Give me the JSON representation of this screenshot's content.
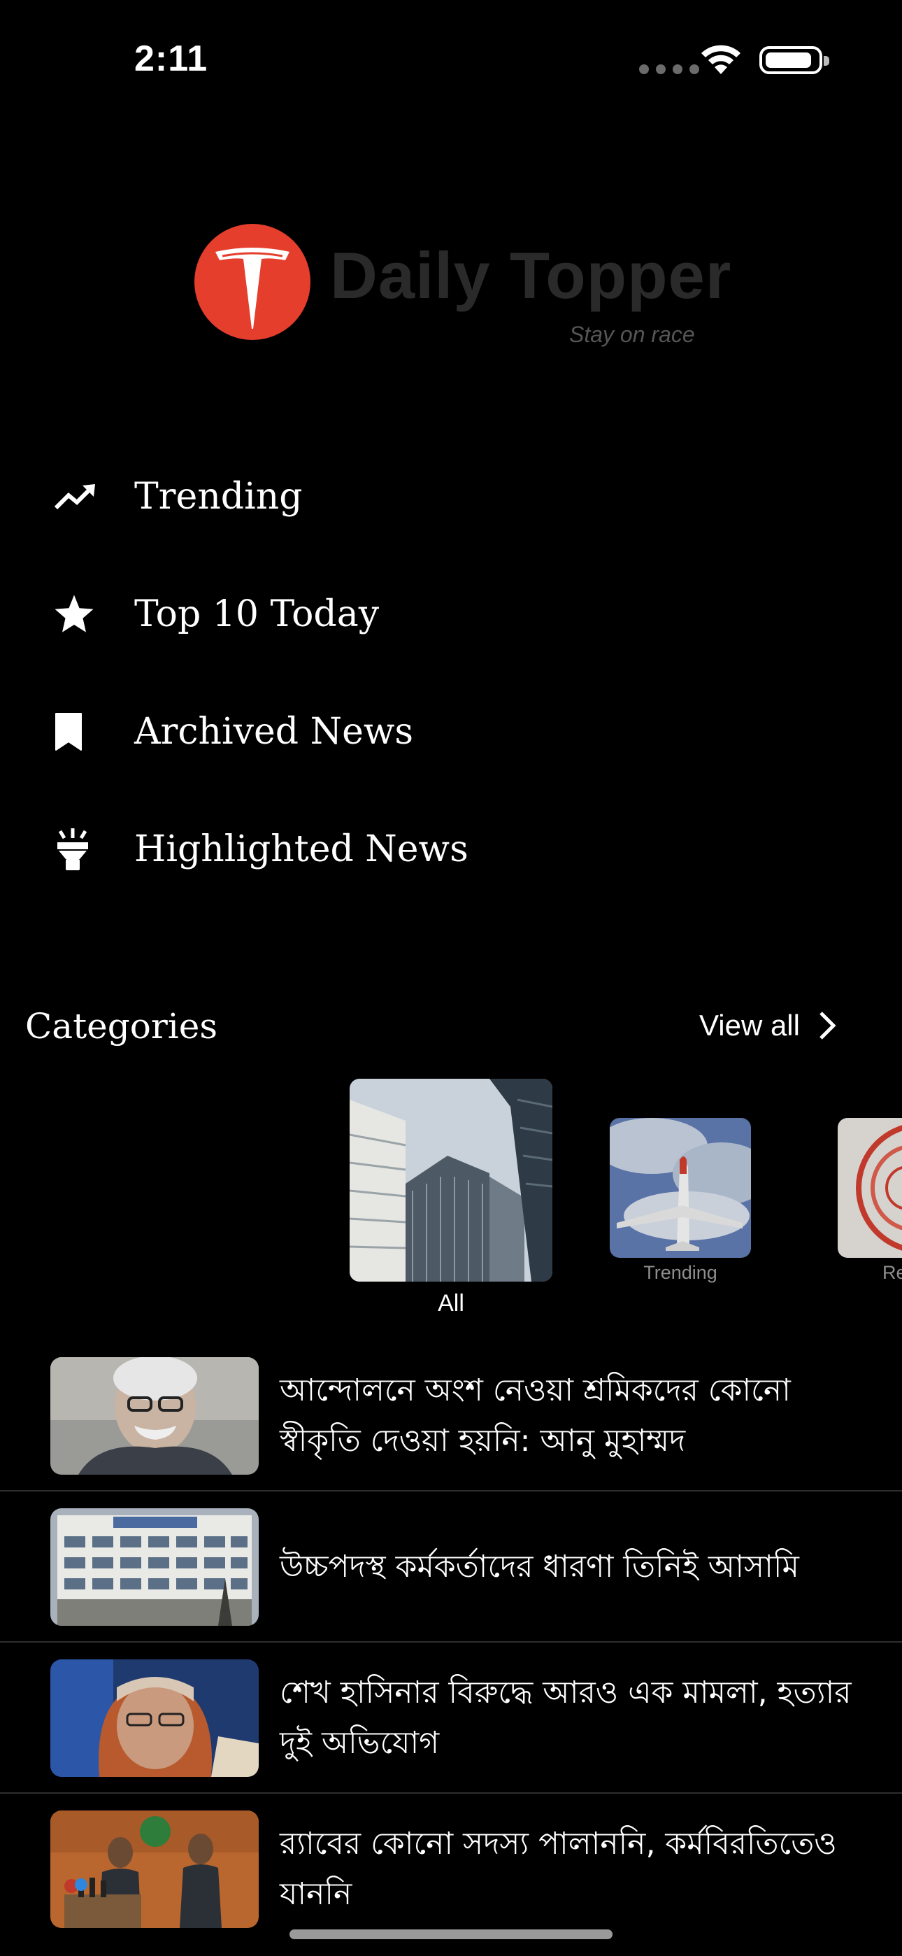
{
  "status_bar": {
    "time": "2:11",
    "battery_level": 0.9
  },
  "logo": {
    "name": "Daily Topper",
    "tagline": "Stay on race",
    "brand_color": "#e53e2c"
  },
  "menu": [
    {
      "label": "Trending",
      "icon": "trending-up-icon"
    },
    {
      "label": "Top 10 Today",
      "icon": "star-icon"
    },
    {
      "label": "Archived News",
      "icon": "bookmark-icon"
    },
    {
      "label": "Highlighted News",
      "icon": "flashlight-icon"
    }
  ],
  "categories": {
    "title": "Categories",
    "view_all": "View all",
    "items": [
      {
        "label": "All",
        "selected": true
      },
      {
        "label": "Trending",
        "selected": false
      },
      {
        "label": "Re",
        "selected": false
      }
    ]
  },
  "news": [
    {
      "title": "আন্দোলনে অংশ নেওয়া শ্রমিকদের কোনো স্বীকৃতি দেওয়া হয়নি: আনু মুহাম্মদ"
    },
    {
      "title": "উচ্চপদস্থ কর্মকর্তাদের ধারণা তিনিই আসামি"
    },
    {
      "title": "শেখ হাসিনার বিরুদ্ধে আরও এক মামলা, হত্যার দুই অভিযোগ"
    },
    {
      "title": "র‍্যাবের কোনো সদস্য পালাননি, কর্মবিরতিতেও যাননি"
    }
  ]
}
